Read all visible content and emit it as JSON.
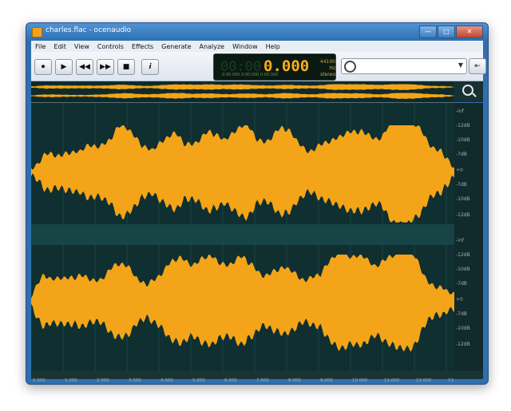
{
  "window": {
    "title": "charles.flac - ocenaudio"
  },
  "titlebar_buttons": {
    "minimize": "—",
    "maximize": "□",
    "close": "✕"
  },
  "menu": [
    "File",
    "Edit",
    "View",
    "Controls",
    "Effects",
    "Generate",
    "Analyze",
    "Window",
    "Help"
  ],
  "transport": {
    "buttons": [
      {
        "name": "record-button",
        "glyph": "⏺"
      },
      {
        "name": "play-button",
        "glyph": "▶"
      },
      {
        "name": "rewind-button",
        "glyph": "◀◀"
      },
      {
        "name": "fast-forward-button",
        "glyph": "▶▶"
      },
      {
        "name": "stop-button",
        "glyph": "■"
      },
      {
        "name": "info-button",
        "glyph": "i"
      }
    ]
  },
  "display": {
    "dim_digits": "00:00",
    "time": "0.000",
    "rate_top": "44100 Hz",
    "rate_bottom": "stereo",
    "small": "0:00.000  0:00.000  0:00.000"
  },
  "selector": {
    "value": ""
  },
  "nav": {
    "back": "⇤",
    "forward": "⇥"
  },
  "amplitude_labels": [
    "-inf",
    "-12dB",
    "-10dB",
    "-7dB",
    "+0",
    "-7dB",
    "-10dB",
    "-12dB"
  ],
  "timeline_labels": [
    "0.000",
    "1.000",
    "2.000",
    "3.000",
    "4.000",
    "5.000",
    "6.000",
    "7.000",
    "8.000",
    "9.000",
    "10.000",
    "11.000",
    "12.000",
    "13.0"
  ],
  "colors": {
    "waveform": "#f4a418",
    "background": "#0f2f30",
    "window_frame": "#2f6fb0"
  }
}
